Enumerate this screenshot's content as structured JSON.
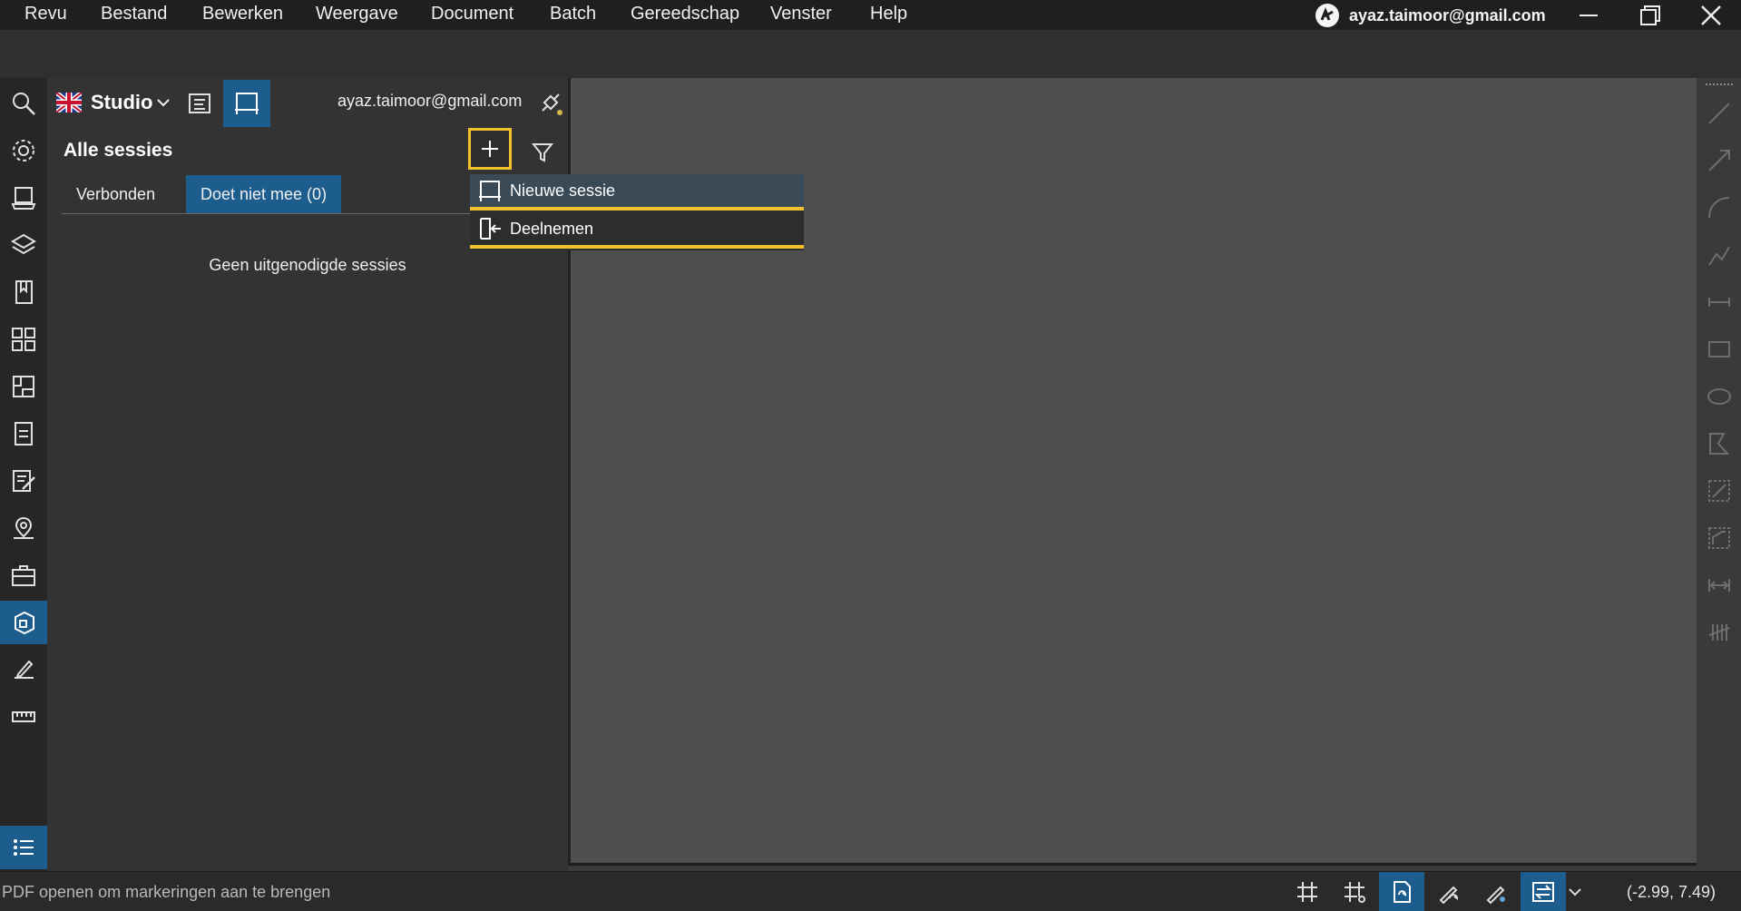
{
  "menubar": {
    "items": [
      "Revu",
      "Bestand",
      "Bewerken",
      "Weergave",
      "Document",
      "Batch",
      "Gereedschap",
      "Venster",
      "Help"
    ],
    "account_email": "ayaz.taimoor@gmail.com"
  },
  "panel": {
    "studio_label": "Studio",
    "user_email": "ayaz.taimoor@gmail.com",
    "title": "Alle sessies",
    "tabs": [
      {
        "label": "Verbonden",
        "active": false
      },
      {
        "label": "Doet niet mee (0)",
        "active": true
      }
    ],
    "empty_message": "Geen uitgenodigde sessies"
  },
  "dropdown": {
    "items": [
      {
        "label": "Nieuwe sessie",
        "icon": "new-session-icon"
      },
      {
        "label": "Deelnemen",
        "icon": "join-icon"
      }
    ]
  },
  "statusbar": {
    "message": "PDF openen om markeringen aan te brengen",
    "coordinates": "(-2.99, 7.49)"
  },
  "colors": {
    "accent": "#1d5d8e",
    "highlight": "#f2c12e",
    "document_bg": "#4f4f4f"
  }
}
